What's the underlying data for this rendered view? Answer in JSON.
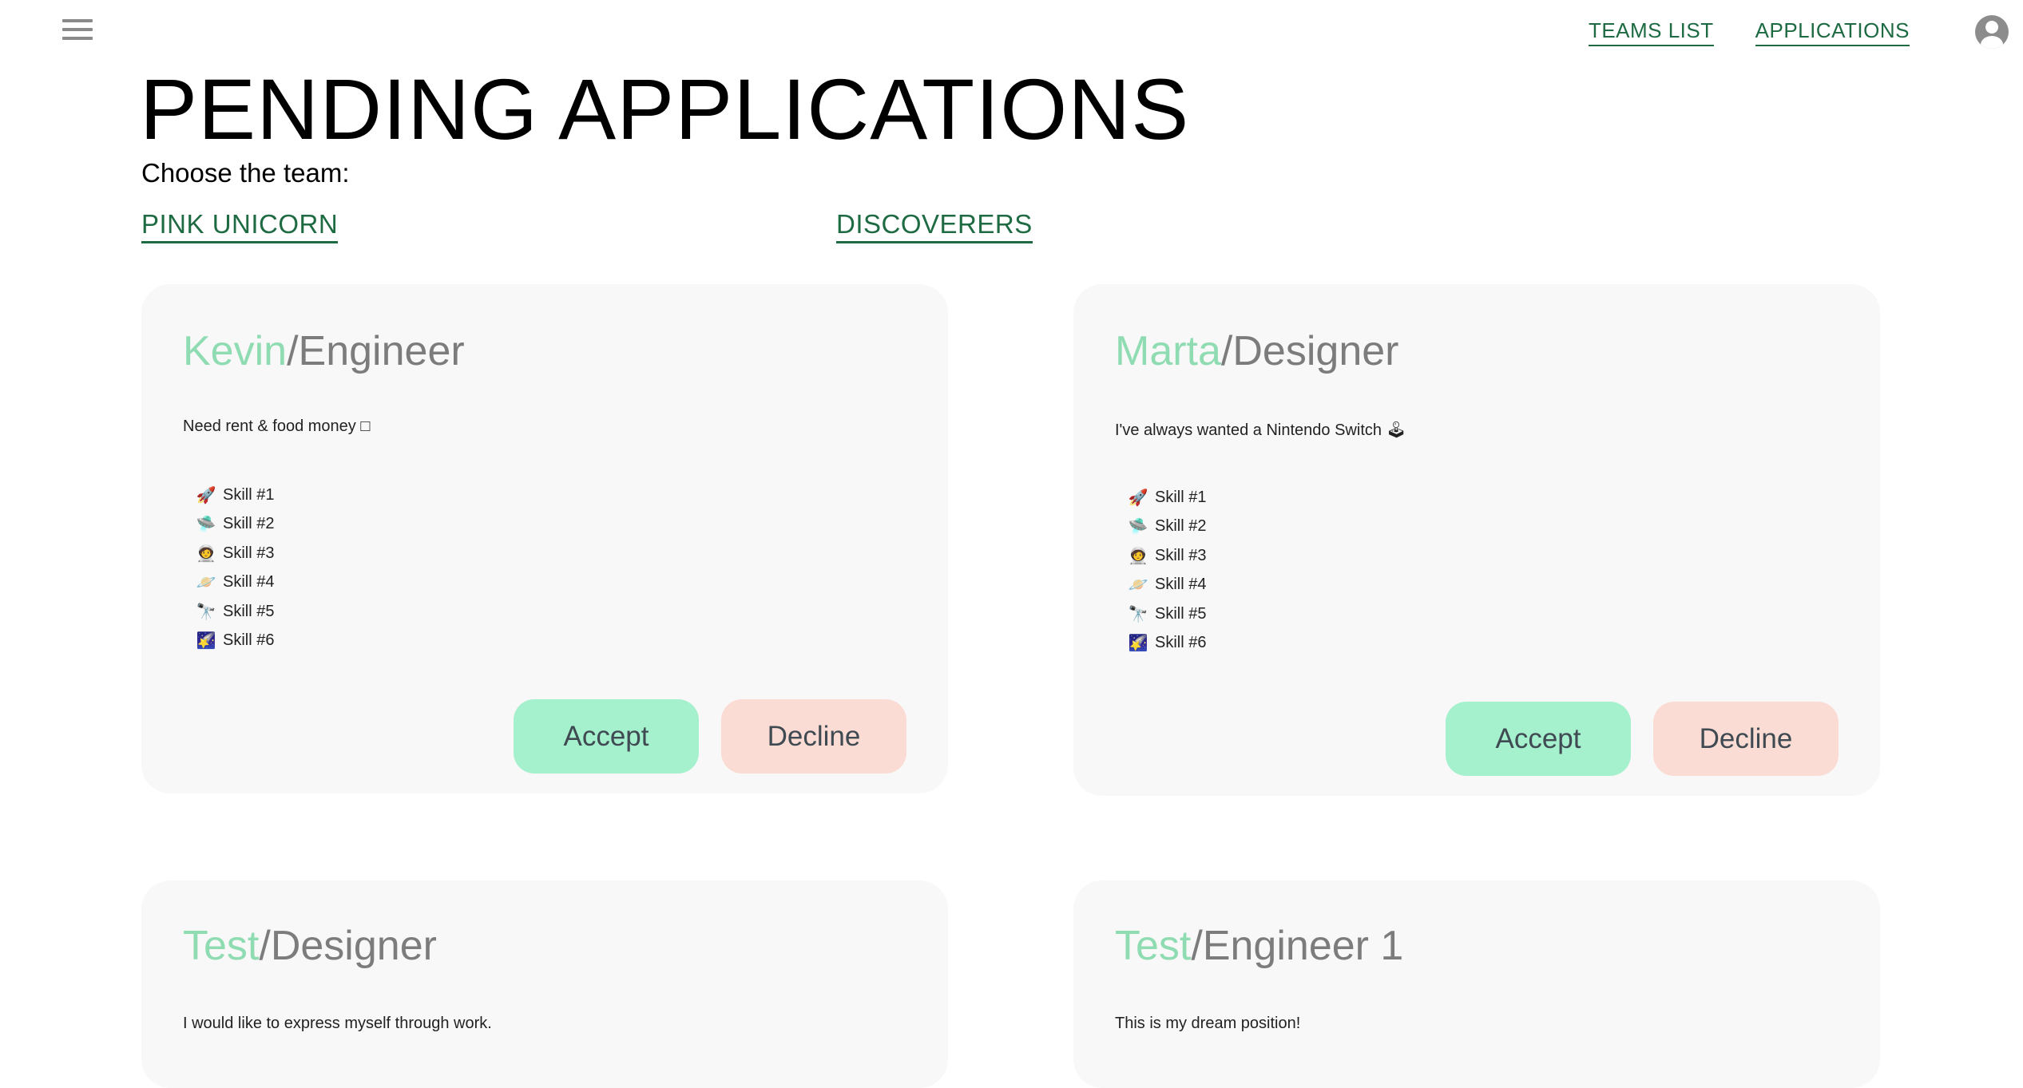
{
  "header": {
    "menu_icon": "hamburger-menu-icon",
    "nav": [
      {
        "label": "TEAMS LIST"
      },
      {
        "label": "APPLICATIONS"
      }
    ],
    "avatar_icon": "account-circle-icon"
  },
  "page": {
    "title": "PENDING APPLICATIONS",
    "choose_label": "Choose the team:",
    "teams": [
      "PINK UNICORN",
      "DISCOVERERS"
    ]
  },
  "applications": [
    {
      "name": "Kevin",
      "separator": "/",
      "role": "Engineer",
      "message": "Need rent & food money □",
      "skills": [
        "Skill #1",
        "Skill #2",
        "Skill #3",
        "Skill #4",
        "Skill #5",
        "Skill #6"
      ],
      "accept_label": "Accept",
      "decline_label": "Decline"
    },
    {
      "name": "Marta",
      "separator": "/",
      "role": "Designer",
      "message": "I've always wanted a Nintendo Switch 🕹",
      "skills": [
        "Skill #1",
        "Skill #2",
        "Skill #3",
        "Skill #4",
        "Skill #5",
        "Skill #6"
      ],
      "accept_label": "Accept",
      "decline_label": "Decline"
    },
    {
      "name": "Test",
      "separator": "/",
      "role": "Designer",
      "message": "I would like to express myself through work."
    },
    {
      "name": "Test",
      "separator": "/",
      "role": "Engineer 1",
      "message": "This is my dream position!"
    }
  ],
  "skill_icons": [
    {
      "name": "rocket-icon",
      "glyph": "🚀"
    },
    {
      "name": "ufo-icon",
      "glyph": "🛸"
    },
    {
      "name": "astronaut-icon",
      "glyph": "🧑‍🚀"
    },
    {
      "name": "ringed-planet-icon",
      "glyph": "🪐"
    },
    {
      "name": "telescope-icon",
      "glyph": "🔭"
    },
    {
      "name": "shooting-star-icon",
      "glyph": "🌠"
    }
  ],
  "colors": {
    "accent_green": "#1e6b43",
    "name_green": "#8fdcb3",
    "role_gray": "#7c7c7c",
    "accept_bg": "#a5f0cd",
    "decline_bg": "#fbdcd4",
    "card_bg": "#f8f8f8"
  }
}
